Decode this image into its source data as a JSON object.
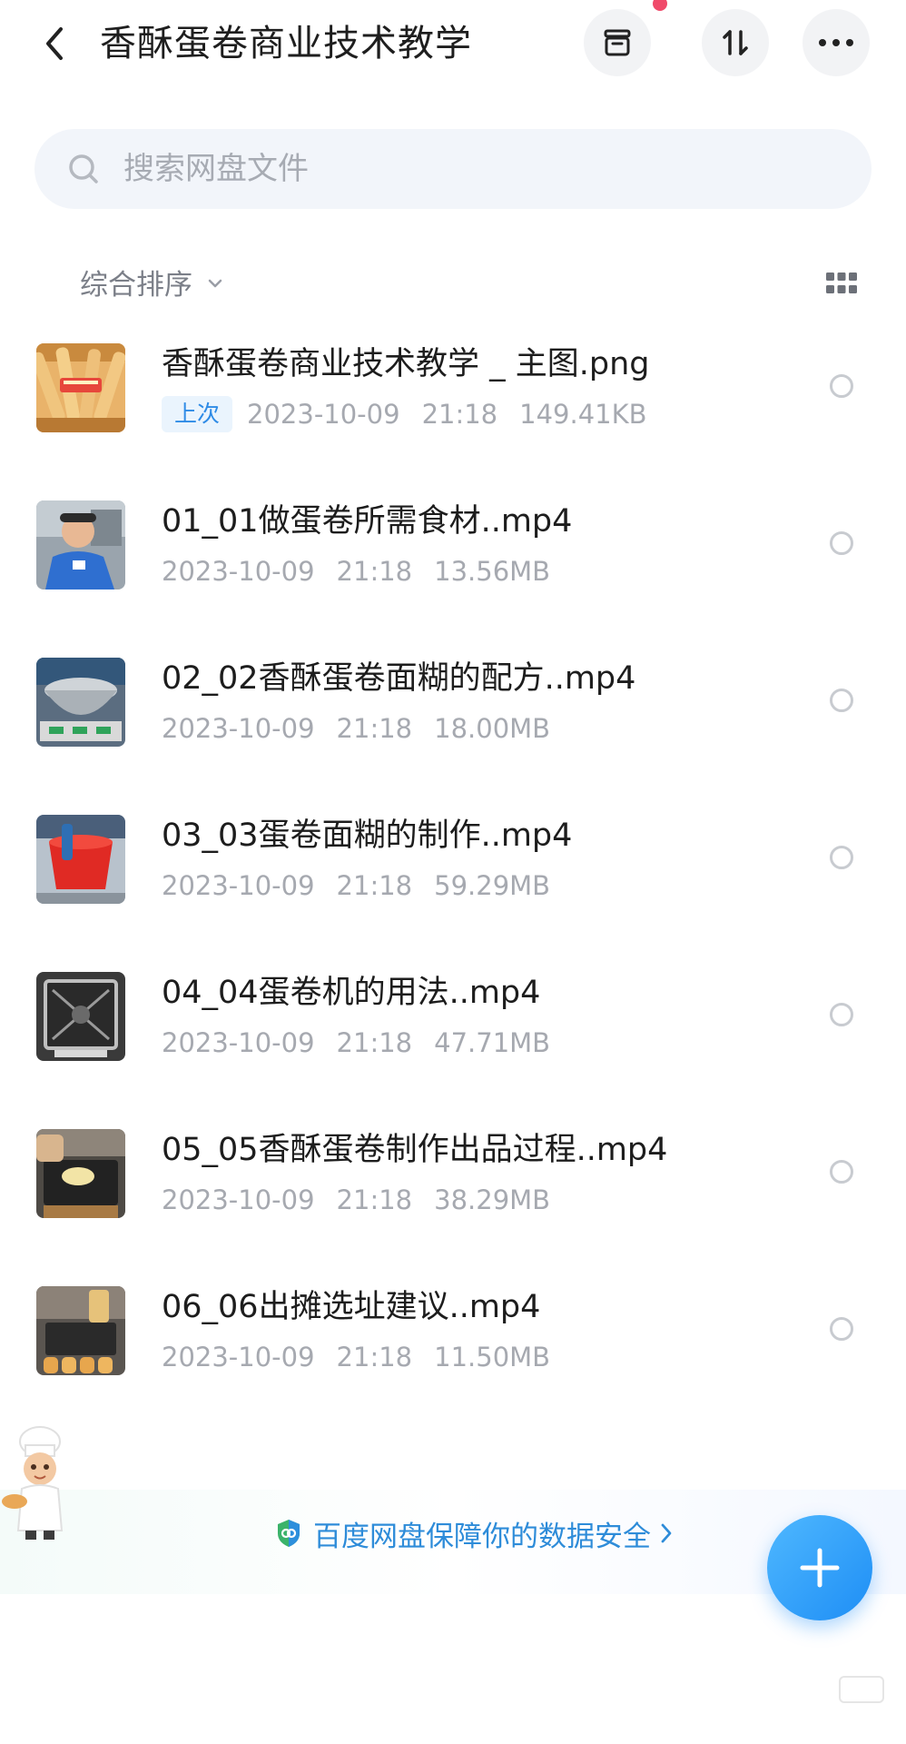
{
  "header": {
    "title": "香酥蛋卷商业技术教学",
    "back_icon": "chevron-left-icon",
    "buttons": [
      "archive-icon",
      "sort-transfer-icon",
      "more-icon"
    ]
  },
  "search": {
    "placeholder": "搜索网盘文件"
  },
  "sort": {
    "label": "综合排序"
  },
  "files": [
    {
      "name": "香酥蛋卷商业技术教学 _ 主图.png",
      "badge": "上次",
      "date": "2023-10-09",
      "time": "21:18",
      "size": "149.41KB"
    },
    {
      "name": "01_01做蛋卷所需食材..mp4",
      "date": "2023-10-09",
      "time": "21:18",
      "size": "13.56MB"
    },
    {
      "name": "02_02香酥蛋卷面糊的配方..mp4",
      "date": "2023-10-09",
      "time": "21:18",
      "size": "18.00MB"
    },
    {
      "name": "03_03蛋卷面糊的制作..mp4",
      "date": "2023-10-09",
      "time": "21:18",
      "size": "59.29MB"
    },
    {
      "name": "04_04蛋卷机的用法..mp4",
      "date": "2023-10-09",
      "time": "21:18",
      "size": "47.71MB"
    },
    {
      "name": "05_05香酥蛋卷制作出品过程..mp4",
      "date": "2023-10-09",
      "time": "21:18",
      "size": "38.29MB"
    },
    {
      "name": "06_06出摊选址建议..mp4",
      "date": "2023-10-09",
      "time": "21:18",
      "size": "11.50MB"
    }
  ],
  "footer": {
    "safety_text": "百度网盘保障你的数据安全"
  },
  "colors": {
    "accent": "#2e8cd9",
    "fab": "#1e8ef5",
    "notify": "#f04a6a"
  }
}
